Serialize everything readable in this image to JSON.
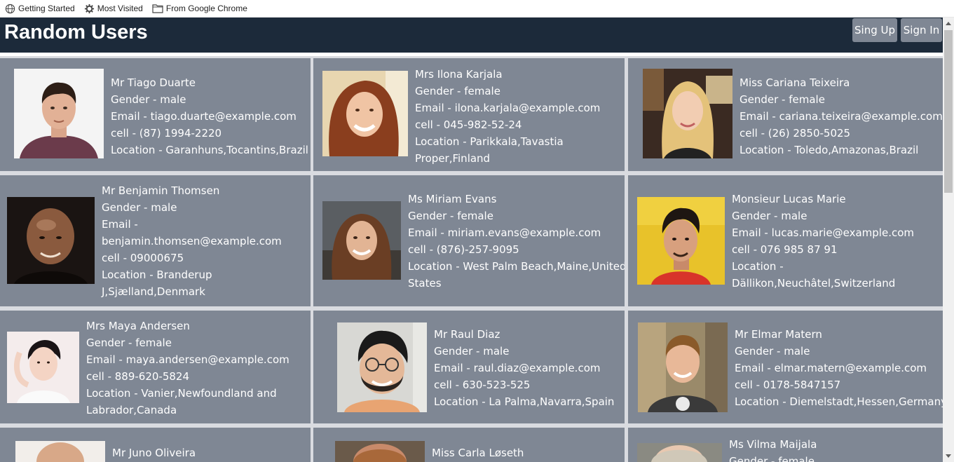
{
  "bookmarks": [
    {
      "label": "Getting Started",
      "icon": "globe-icon"
    },
    {
      "label": "Most Visited",
      "icon": "gear-icon"
    },
    {
      "label": "From Google Chrome",
      "icon": "folder-icon"
    }
  ],
  "header": {
    "title": "Random Users",
    "signup_label": "Sing Up",
    "signin_label": "Sign In"
  },
  "users": [
    {
      "name": "Mr Tiago Duarte",
      "gender": "Gender - male",
      "email": "Email - tiago.duarte@example.com",
      "cell": "cell - (87) 1994-2220",
      "location": "Location - Garanhuns,Tocantins,Brazil"
    },
    {
      "name": "Mrs Ilona Karjala",
      "gender": "Gender - female",
      "email": "Email - ilona.karjala@example.com",
      "cell": "cell - 045-982-52-24",
      "location": "Location - Parikkala,Tavastia",
      "location2": "Proper,Finland"
    },
    {
      "name": "Miss Cariana Teixeira",
      "gender": "Gender - female",
      "email": "Email - cariana.teixeira@example.com",
      "cell": "cell - (26) 2850-5025",
      "location": "Location - Toledo,Amazonas,Brazil"
    },
    {
      "name": "Mr Benjamin Thomsen",
      "gender": "Gender - male",
      "email": "Email -",
      "email2": "benjamin.thomsen@example.com",
      "cell": "cell - 09000675",
      "location": "Location - Branderup",
      "location2": "J,Sjælland,Denmark"
    },
    {
      "name": "Ms Miriam Evans",
      "gender": "Gender - female",
      "email": "Email - miriam.evans@example.com",
      "cell": "cell - (876)-257-9095",
      "location": "Location - West Palm Beach,Maine,United",
      "location2": "States"
    },
    {
      "name": "Monsieur Lucas Marie",
      "gender": "Gender - male",
      "email": "Email - lucas.marie@example.com",
      "cell": "cell - 076 985 87 91",
      "location": "Location -",
      "location2": "Dällikon,Neuchâtel,Switzerland"
    },
    {
      "name": "Mrs Maya Andersen",
      "gender": "Gender - female",
      "email": "Email - maya.andersen@example.com",
      "cell": "cell - 889-620-5824",
      "location": "Location - Vanier,Newfoundland and",
      "location2": "Labrador,Canada"
    },
    {
      "name": "Mr Raul Diaz",
      "gender": "Gender - male",
      "email": "Email - raul.diaz@example.com",
      "cell": "cell - 630-523-525",
      "location": "Location - La Palma,Navarra,Spain"
    },
    {
      "name": "Mr Elmar Matern",
      "gender": "Gender - male",
      "email": "Email - elmar.matern@example.com",
      "cell": "cell - 0178-5847157",
      "location": "Location - Diemelstadt,Hessen,Germany"
    },
    {
      "name": "Mr Juno Oliveira",
      "gender": "",
      "email": "",
      "cell": "",
      "location": ""
    },
    {
      "name": "Miss Carla Løseth",
      "gender": "",
      "email": "",
      "cell": "",
      "location": ""
    },
    {
      "name": "Ms Vilma Maijala",
      "gender": "Gender - female",
      "email": "",
      "cell": "",
      "location": ""
    }
  ],
  "colors": {
    "header_bg": "#1c2a3a",
    "card_bg": "#7f8794",
    "button_bg": "#7f8794",
    "grid_gap": "#d9dbe0"
  }
}
